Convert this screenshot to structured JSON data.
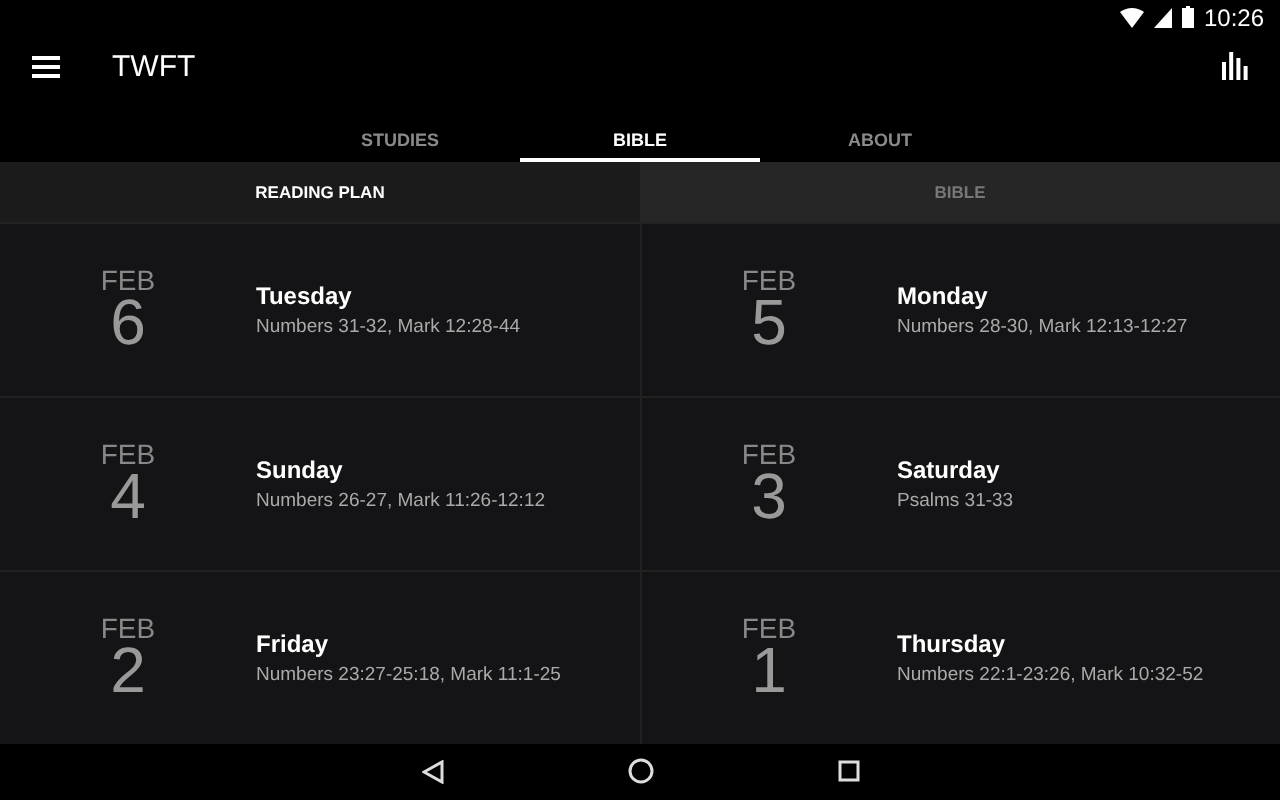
{
  "status_bar": {
    "time": "10:26"
  },
  "app_bar": {
    "title": "TWFT"
  },
  "tabs": [
    {
      "label": "STUDIES",
      "selected": false
    },
    {
      "label": "BIBLE",
      "selected": true
    },
    {
      "label": "ABOUT",
      "selected": false
    }
  ],
  "sub_tabs": [
    {
      "label": "READING PLAN",
      "selected": true
    },
    {
      "label": "BIBLE",
      "selected": false
    }
  ],
  "days": [
    {
      "month": "FEB",
      "day": "6",
      "weekday": "Tuesday",
      "reading": "Numbers 31-32, Mark 12:28-44"
    },
    {
      "month": "FEB",
      "day": "5",
      "weekday": "Monday",
      "reading": "Numbers 28-30, Mark 12:13-12:27"
    },
    {
      "month": "FEB",
      "day": "4",
      "weekday": "Sunday",
      "reading": "Numbers 26-27, Mark 11:26-12:12"
    },
    {
      "month": "FEB",
      "day": "3",
      "weekday": "Saturday",
      "reading": "Psalms 31-33"
    },
    {
      "month": "FEB",
      "day": "2",
      "weekday": "Friday",
      "reading": "Numbers 23:27-25:18, Mark 11:1-25"
    },
    {
      "month": "FEB",
      "day": "1",
      "weekday": "Thursday",
      "reading": "Numbers 22:1-23:26, Mark 10:32-52"
    }
  ]
}
